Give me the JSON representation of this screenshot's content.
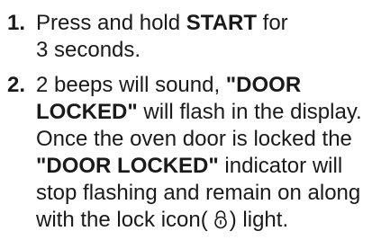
{
  "steps": [
    {
      "number": "1.",
      "line1_a": "Press and hold ",
      "line1_b": "START",
      "line1_c": " for",
      "line2": "3 seconds."
    },
    {
      "number": "2.",
      "line1_a": "2 beeps will sound, ",
      "line1_b": "\"DOOR",
      "line2_a": "LOCKED\"",
      "line2_b": " will flash in the display.",
      "line3": "Once the oven door is locked the",
      "line4_a": "\"DOOR LOCKED\"",
      "line4_b": " indicator will",
      "line5": "stop flashing and remain on along",
      "line6_a": "with the lock icon(",
      "line6_b": ") light.",
      "lock_icon": "padlock-icon"
    }
  ]
}
